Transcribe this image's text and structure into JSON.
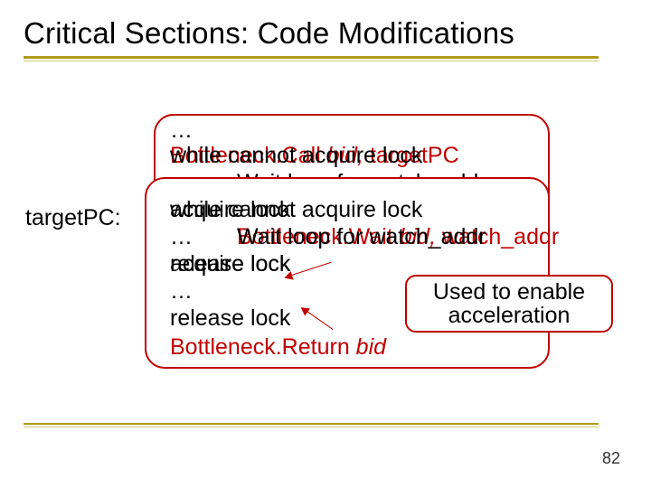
{
  "title": "Critical Sections: Code Modifications",
  "label": "targetPC:",
  "dots": "…",
  "back": {
    "l1a": "Bottleneck.Call ",
    "l1b": "bid,",
    "l1c": " targetPC",
    "ov1": "while cannot acquire lock",
    "wait1": "Wait loop for watch_addr",
    "l2": "while cannot acquire lock",
    "ov2": "acquire lock",
    "l3a": "Bottleneck.Wait ",
    "l3b": "bid,",
    "l3c": " watch_addr",
    "ov3": "Wait loop for watch_addr",
    "l4": "acquire lock",
    "ov4": "release lock",
    "l5": "release lock",
    "l6a": "Bottleneck.Return ",
    "l6b": "bid"
  },
  "callout": "Used to enable acceleration",
  "pagenum": "82"
}
